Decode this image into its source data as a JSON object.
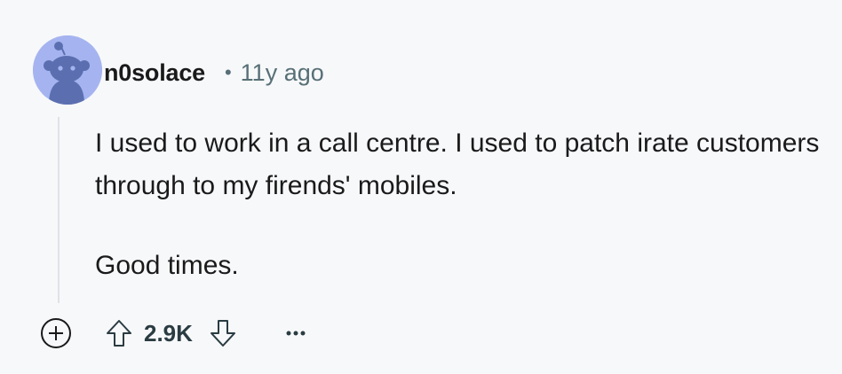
{
  "comment": {
    "author": "n0solace",
    "separator": "•",
    "age": "11y ago",
    "paragraphs": [
      "I used to work in a call centre. I used to patch irate customers through to my firends' mobiles.",
      "Good times."
    ],
    "score": "2.9K"
  },
  "icons": {
    "avatar": "snoo-avatar",
    "expand": "plus-circle-icon",
    "upvote": "arrow-up-icon",
    "downvote": "arrow-down-icon",
    "more": "more-options-icon"
  },
  "colors": {
    "background": "#f7f8fa",
    "avatar_bg": "#a5b4f0",
    "avatar_figure": "#5b6fb0",
    "text": "#1a1a1b",
    "meta": "#576f76",
    "thread_line": "#dfe2e6"
  }
}
